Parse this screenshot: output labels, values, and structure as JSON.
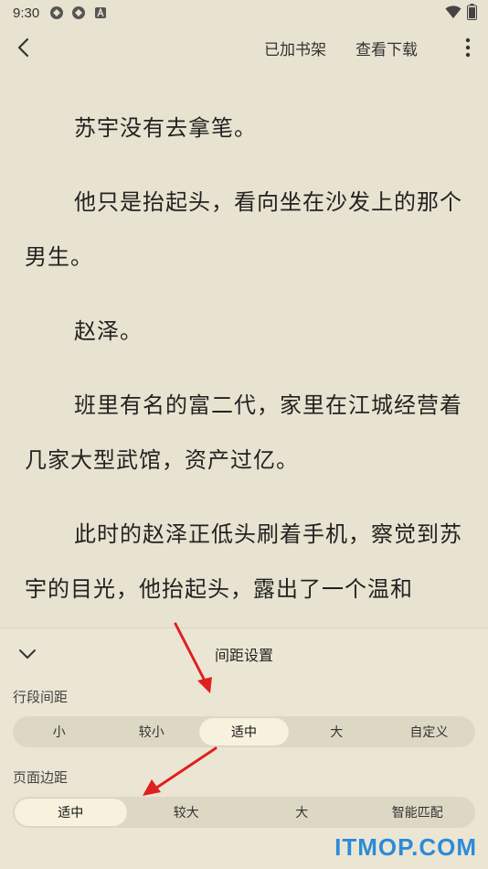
{
  "status_bar": {
    "time": "9:30",
    "icons": [
      "app-icon",
      "app-icon",
      "a-icon"
    ],
    "right_icons": [
      "wifi-icon",
      "battery-icon"
    ]
  },
  "top_bar": {
    "back_icon": "chevron-left-icon",
    "add_to_shelf": "已加书架",
    "view_download": "查看下载",
    "more_icon": "more-vertical-icon"
  },
  "content": {
    "paragraphs": [
      "苏宇没有去拿笔。",
      "他只是抬起头，看向坐在沙发上的那个男生。",
      "赵泽。",
      "班里有名的富二代，家里在江城经营着几家大型武馆，资产过亿。",
      "此时的赵泽正低头刷着手机，察觉到苏宇的目光，他抬起头，露出了一个温和"
    ]
  },
  "panel": {
    "title": "间距设置",
    "collapse_icon": "chevron-down-icon",
    "line_spacing": {
      "label": "行段间距",
      "options": [
        "小",
        "较小",
        "适中",
        "大",
        "自定义"
      ],
      "selected": "适中"
    },
    "page_margin": {
      "label": "页面边距",
      "options": [
        "适中",
        "较大",
        "大",
        "智能匹配"
      ],
      "selected": "适中"
    }
  },
  "watermark": "ITMOP.COM",
  "colors": {
    "background": "#e8e3d0",
    "panel": "#ebe6d3",
    "segment_bg": "#ddd8c4",
    "segment_active": "#f7f1de",
    "annotation_arrow": "#e02020",
    "watermark": "#2b8bd9"
  }
}
